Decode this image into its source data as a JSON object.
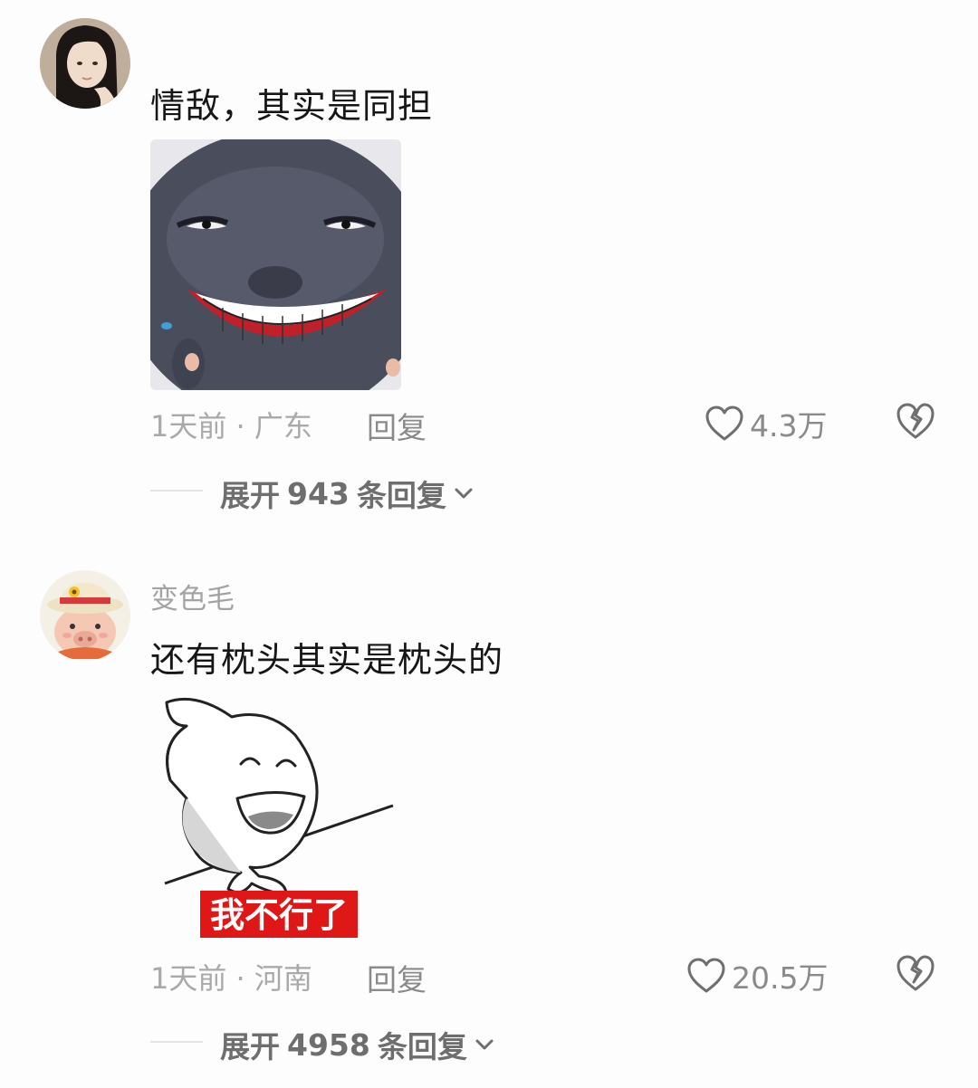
{
  "comments": [
    {
      "username": "",
      "text": "情敌，其实是同担",
      "time": "1天前",
      "location": "广东",
      "reply_label": "回复",
      "likes": "4.3万",
      "expand_label": "展开",
      "reply_count": "943",
      "reply_suffix": "条回复",
      "sticker": "grinning-dark-face-sticker"
    },
    {
      "username": "变色毛",
      "text": "还有枕头其实是枕头的",
      "time": "1天前",
      "location": "河南",
      "reply_label": "回复",
      "likes": "20.5万",
      "expand_label": "展开",
      "reply_count": "4958",
      "reply_suffix": "条回复",
      "sticker": "laughing-bunny-sticker",
      "sticker_caption": "我不行了"
    }
  ],
  "icons": {
    "like": "heart-outline-icon",
    "dislike": "broken-heart-icon",
    "expand": "chevron-down-icon"
  },
  "colors": {
    "caption_bg": "#e01717",
    "meta_gray": "#a9a9a9"
  }
}
